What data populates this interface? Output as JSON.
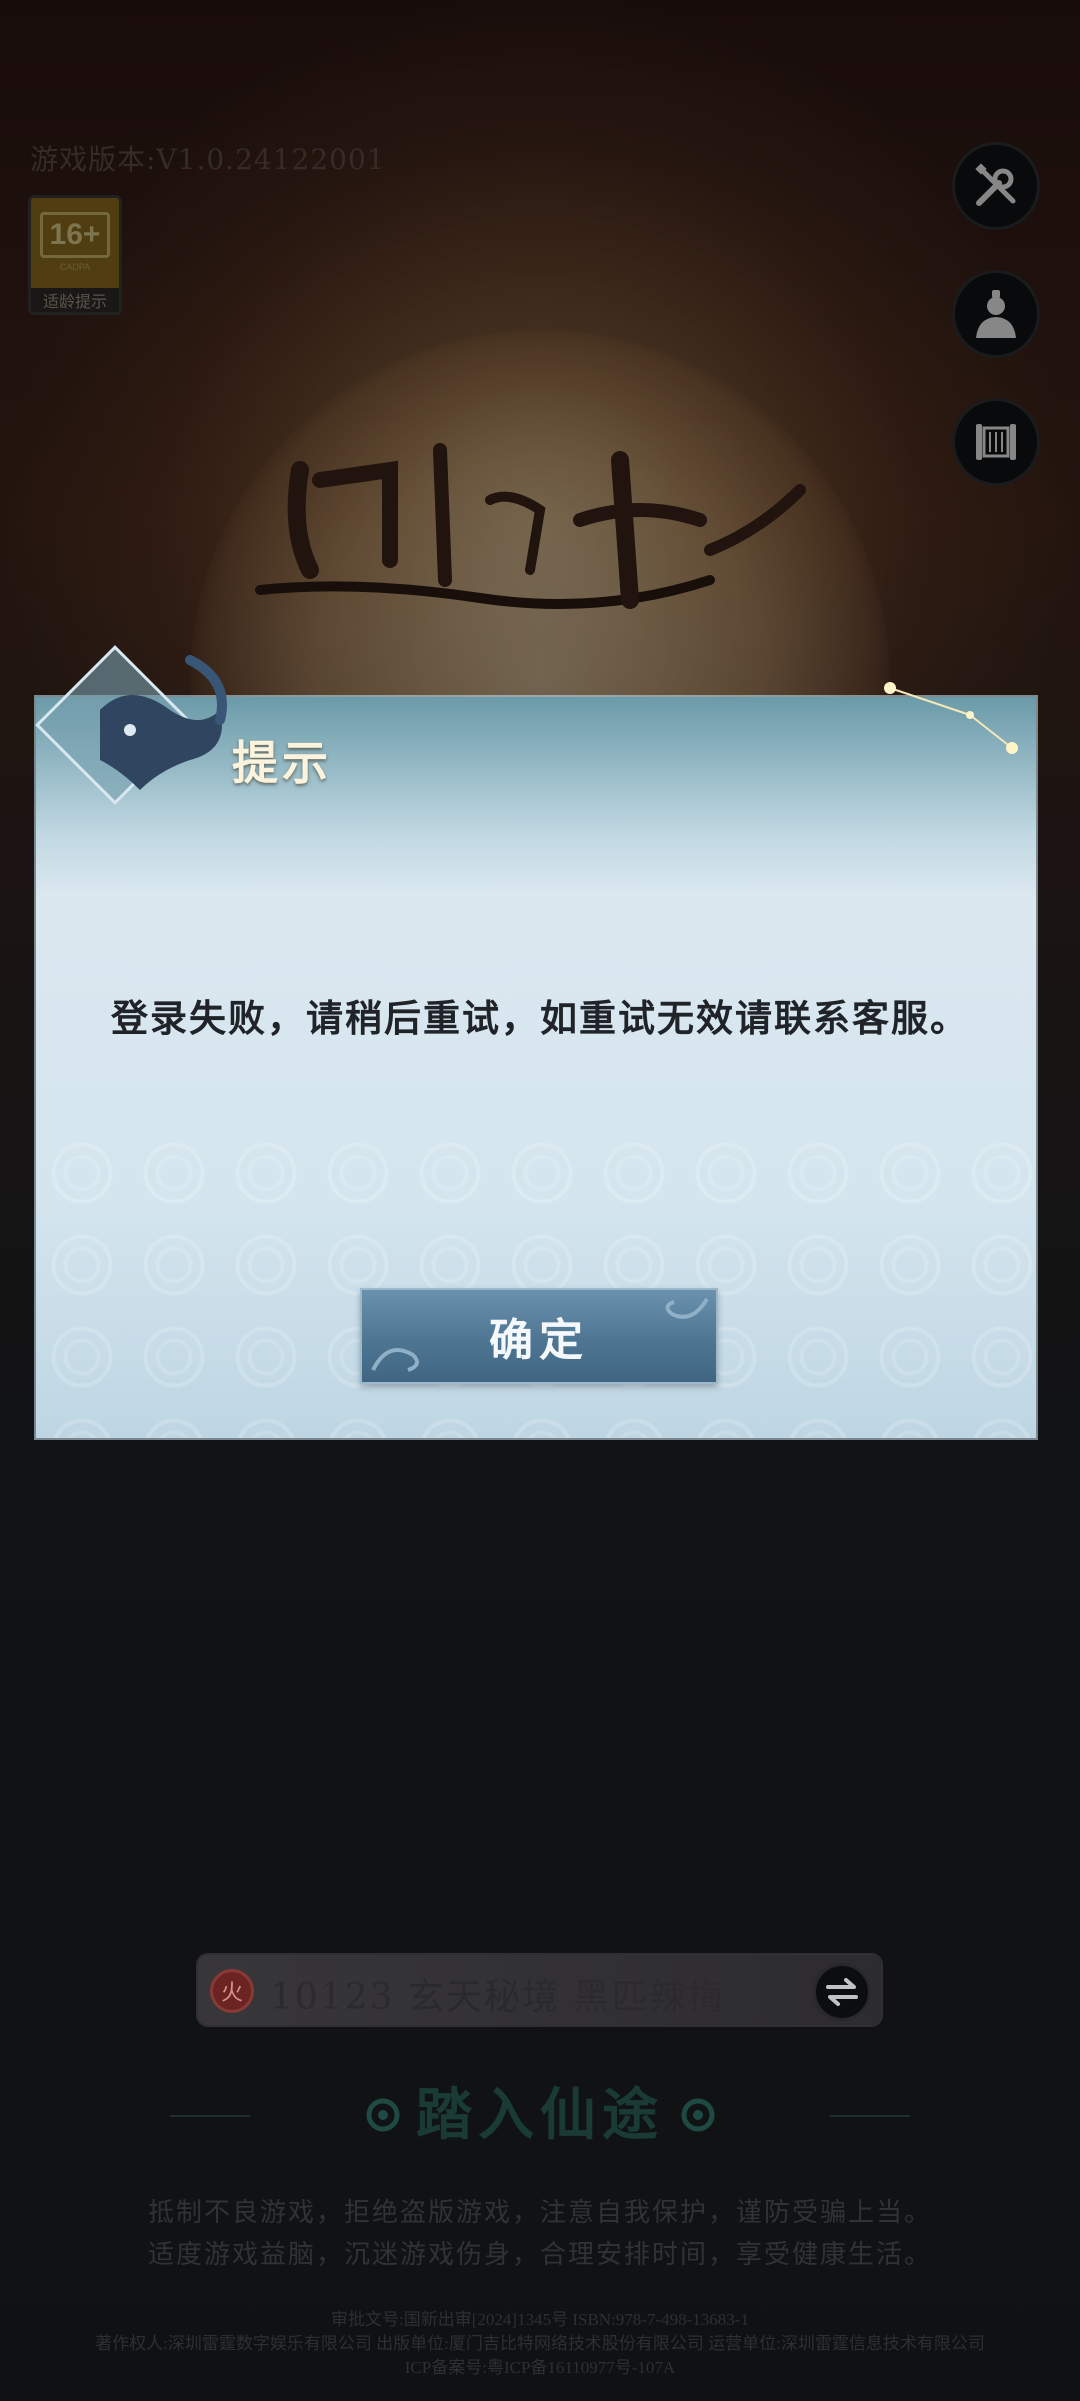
{
  "game": {
    "version_text": "游戏版本:V1.0.24122001",
    "age_rating": {
      "number": "16+",
      "sub": "CADPA",
      "label": "适龄提示"
    }
  },
  "side_buttons": [
    {
      "name": "settings-button",
      "icon": "wrench-screwdriver-icon"
    },
    {
      "name": "account-button",
      "icon": "scholar-avatar-icon"
    },
    {
      "name": "announcement-button",
      "icon": "scroll-icon"
    }
  ],
  "dialog": {
    "title": "提示",
    "message": "登录失败，请稍后重试，如重试无效请联系客服。",
    "confirm_label": "确定"
  },
  "server": {
    "element": "火",
    "id": "10123",
    "zone": "玄天秘境",
    "name": "黑匹辣梅"
  },
  "enter_label": "踏入仙途",
  "health_notice": [
    "抵制不良游戏，拒绝盗版游戏，注意自我保护，谨防受骗上当。",
    "适度游戏益脑，沉迷游戏伤身，合理安排时间，享受健康生活。"
  ],
  "legal": [
    "审批文号:国新出审[2024]1345号 ISBN:978-7-498-13683-1",
    "著作权人:深圳雷霆数字娱乐有限公司 出版单位:厦门吉比特网络技术股份有限公司 运营单位:深圳雷霆信息技术有限公司",
    "ICP备案号:粤ICP备16110977号-107A"
  ],
  "colors": {
    "dialog_header": "#6b9aa8",
    "dialog_body": "#d4e5ee",
    "confirm_button": "#4e7693",
    "enter_text": "#1a3b35"
  }
}
